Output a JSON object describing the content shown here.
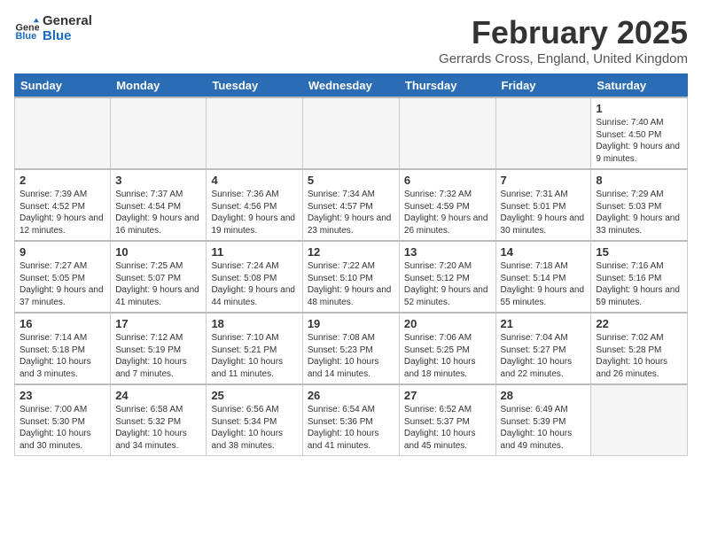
{
  "logo": {
    "text_general": "General",
    "text_blue": "Blue"
  },
  "title": "February 2025",
  "location": "Gerrards Cross, England, United Kingdom",
  "headers": [
    "Sunday",
    "Monday",
    "Tuesday",
    "Wednesday",
    "Thursday",
    "Friday",
    "Saturday"
  ],
  "weeks": [
    [
      {
        "day": "",
        "detail": ""
      },
      {
        "day": "",
        "detail": ""
      },
      {
        "day": "",
        "detail": ""
      },
      {
        "day": "",
        "detail": ""
      },
      {
        "day": "",
        "detail": ""
      },
      {
        "day": "",
        "detail": ""
      },
      {
        "day": "1",
        "detail": "Sunrise: 7:40 AM\nSunset: 4:50 PM\nDaylight: 9 hours and 9 minutes."
      }
    ],
    [
      {
        "day": "2",
        "detail": "Sunrise: 7:39 AM\nSunset: 4:52 PM\nDaylight: 9 hours and 12 minutes."
      },
      {
        "day": "3",
        "detail": "Sunrise: 7:37 AM\nSunset: 4:54 PM\nDaylight: 9 hours and 16 minutes."
      },
      {
        "day": "4",
        "detail": "Sunrise: 7:36 AM\nSunset: 4:56 PM\nDaylight: 9 hours and 19 minutes."
      },
      {
        "day": "5",
        "detail": "Sunrise: 7:34 AM\nSunset: 4:57 PM\nDaylight: 9 hours and 23 minutes."
      },
      {
        "day": "6",
        "detail": "Sunrise: 7:32 AM\nSunset: 4:59 PM\nDaylight: 9 hours and 26 minutes."
      },
      {
        "day": "7",
        "detail": "Sunrise: 7:31 AM\nSunset: 5:01 PM\nDaylight: 9 hours and 30 minutes."
      },
      {
        "day": "8",
        "detail": "Sunrise: 7:29 AM\nSunset: 5:03 PM\nDaylight: 9 hours and 33 minutes."
      }
    ],
    [
      {
        "day": "9",
        "detail": "Sunrise: 7:27 AM\nSunset: 5:05 PM\nDaylight: 9 hours and 37 minutes."
      },
      {
        "day": "10",
        "detail": "Sunrise: 7:25 AM\nSunset: 5:07 PM\nDaylight: 9 hours and 41 minutes."
      },
      {
        "day": "11",
        "detail": "Sunrise: 7:24 AM\nSunset: 5:08 PM\nDaylight: 9 hours and 44 minutes."
      },
      {
        "day": "12",
        "detail": "Sunrise: 7:22 AM\nSunset: 5:10 PM\nDaylight: 9 hours and 48 minutes."
      },
      {
        "day": "13",
        "detail": "Sunrise: 7:20 AM\nSunset: 5:12 PM\nDaylight: 9 hours and 52 minutes."
      },
      {
        "day": "14",
        "detail": "Sunrise: 7:18 AM\nSunset: 5:14 PM\nDaylight: 9 hours and 55 minutes."
      },
      {
        "day": "15",
        "detail": "Sunrise: 7:16 AM\nSunset: 5:16 PM\nDaylight: 9 hours and 59 minutes."
      }
    ],
    [
      {
        "day": "16",
        "detail": "Sunrise: 7:14 AM\nSunset: 5:18 PM\nDaylight: 10 hours and 3 minutes."
      },
      {
        "day": "17",
        "detail": "Sunrise: 7:12 AM\nSunset: 5:19 PM\nDaylight: 10 hours and 7 minutes."
      },
      {
        "day": "18",
        "detail": "Sunrise: 7:10 AM\nSunset: 5:21 PM\nDaylight: 10 hours and 11 minutes."
      },
      {
        "day": "19",
        "detail": "Sunrise: 7:08 AM\nSunset: 5:23 PM\nDaylight: 10 hours and 14 minutes."
      },
      {
        "day": "20",
        "detail": "Sunrise: 7:06 AM\nSunset: 5:25 PM\nDaylight: 10 hours and 18 minutes."
      },
      {
        "day": "21",
        "detail": "Sunrise: 7:04 AM\nSunset: 5:27 PM\nDaylight: 10 hours and 22 minutes."
      },
      {
        "day": "22",
        "detail": "Sunrise: 7:02 AM\nSunset: 5:28 PM\nDaylight: 10 hours and 26 minutes."
      }
    ],
    [
      {
        "day": "23",
        "detail": "Sunrise: 7:00 AM\nSunset: 5:30 PM\nDaylight: 10 hours and 30 minutes."
      },
      {
        "day": "24",
        "detail": "Sunrise: 6:58 AM\nSunset: 5:32 PM\nDaylight: 10 hours and 34 minutes."
      },
      {
        "day": "25",
        "detail": "Sunrise: 6:56 AM\nSunset: 5:34 PM\nDaylight: 10 hours and 38 minutes."
      },
      {
        "day": "26",
        "detail": "Sunrise: 6:54 AM\nSunset: 5:36 PM\nDaylight: 10 hours and 41 minutes."
      },
      {
        "day": "27",
        "detail": "Sunrise: 6:52 AM\nSunset: 5:37 PM\nDaylight: 10 hours and 45 minutes."
      },
      {
        "day": "28",
        "detail": "Sunrise: 6:49 AM\nSunset: 5:39 PM\nDaylight: 10 hours and 49 minutes."
      },
      {
        "day": "",
        "detail": ""
      }
    ]
  ]
}
